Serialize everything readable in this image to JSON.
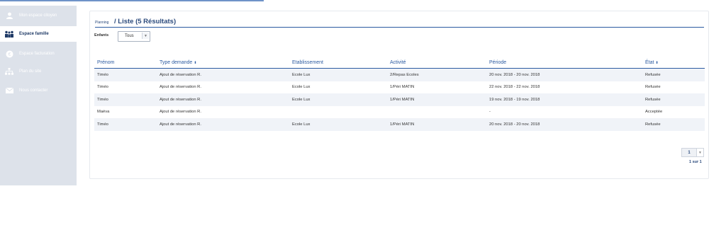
{
  "sidebar": {
    "items": [
      {
        "label": "Mon espace citoyen",
        "icon": "user-icon",
        "active": false
      },
      {
        "label": "Espace famille",
        "icon": "family-icon",
        "active": true
      },
      {
        "label": "Espace facturation",
        "icon": "euro-icon",
        "active": false
      },
      {
        "label": "Plan du site",
        "icon": "sitemap-icon",
        "active": false
      },
      {
        "label": "Nous contacter",
        "icon": "envelope-icon",
        "active": false
      }
    ]
  },
  "header": {
    "breadcrumb": "Planning",
    "separator": "/",
    "title": "Liste (5 Résultats)"
  },
  "filter": {
    "label": "Enfants",
    "value": "Tous"
  },
  "table": {
    "columns": [
      "Prénom",
      "Type demande",
      "Etablissement",
      "Activité",
      "Période",
      "État"
    ],
    "sortable": [
      false,
      true,
      false,
      false,
      false,
      true
    ],
    "rows": [
      [
        "Timéo",
        "Ajout de réservation R.",
        "Ecole Lux",
        "2/Repas Ecoles",
        "20 nov. 2018 - 20 nov. 2018",
        "Refusée"
      ],
      [
        "Timéo",
        "Ajout de réservation R.",
        "Ecole Lux",
        "1/Péri MATIN",
        "22 nov. 2018 - 22 nov. 2018",
        "Refusée"
      ],
      [
        "Timéo",
        "Ajout de réservation R.",
        "Ecole Lux",
        "1/Péri MATIN",
        "19 nov. 2018 - 19 nov. 2018",
        "Refusée"
      ],
      [
        "Maéva",
        "Ajout de réservation R.",
        "",
        "",
        "-",
        "Acceptée"
      ],
      [
        "Timéo",
        "Ajout de réservation R.",
        "Ecole Lux",
        "1/Péri MATIN",
        "20 nov. 2018 - 20 nov. 2018",
        "Refusée"
      ]
    ]
  },
  "pagination": {
    "current": "1",
    "info": "1 sur 1"
  },
  "colors": {
    "accent": "#2b5aa0",
    "sidebar_bg": "#dde2ea",
    "row_stripe": "#f0f3f8"
  }
}
